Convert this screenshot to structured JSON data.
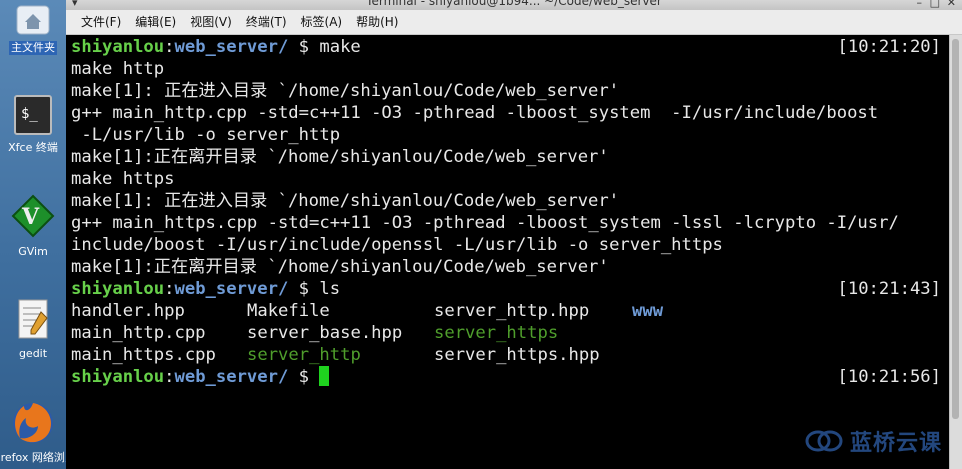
{
  "desktop": {
    "icons": [
      {
        "label": "主文件夹",
        "icon": "home-folder-icon"
      },
      {
        "label": "Xfce 终端",
        "icon": "terminal-icon"
      },
      {
        "label": "GVim",
        "icon": "gvim-icon"
      },
      {
        "label": "gedit",
        "icon": "gedit-icon"
      },
      {
        "label": "Firefox 网络浏览器",
        "icon": "firefox-icon"
      }
    ]
  },
  "window": {
    "title": "Terminal - shiyanlou@1b94... ~/Code/web_server",
    "menu": [
      "文件(F)",
      "编辑(E)",
      "视图(V)",
      "终端(T)",
      "标签(A)",
      "帮助(H)"
    ]
  },
  "terminal": {
    "prompt_user": "shiyanlou",
    "prompt_sep": ":",
    "prompt_dir": "web_server/",
    "prompt_end": " $ ",
    "cmd1": "make",
    "ts1": "[10:21:20]",
    "out": [
      "make http",
      "make[1]: 正在进入目录 `/home/shiyanlou/Code/web_server'",
      "g++ main_http.cpp -std=c++11 -O3 -pthread -lboost_system  -I/usr/include/boost",
      " -L/usr/lib -o server_http",
      "make[1]:正在离开目录 `/home/shiyanlou/Code/web_server'",
      "make https",
      "make[1]: 正在进入目录 `/home/shiyanlou/Code/web_server'",
      "g++ main_https.cpp -std=c++11 -O3 -pthread -lboost_system -lssl -lcrypto -I/usr/",
      "include/boost -I/usr/include/openssl -L/usr/lib -o server_https",
      "make[1]:正在离开目录 `/home/shiyanlou/Code/web_server'"
    ],
    "cmd2": "ls",
    "ts2": "[10:21:43]",
    "ls": [
      [
        "handler.hpp",
        "Makefile",
        "server_http.hpp",
        "www"
      ],
      [
        "main_http.cpp",
        "server_base.hpp",
        "server_https",
        ""
      ],
      [
        "main_https.cpp",
        "server_http",
        "server_https.hpp",
        ""
      ]
    ],
    "ts3": "[10:21:56]"
  },
  "watermark": "蓝桥云课"
}
